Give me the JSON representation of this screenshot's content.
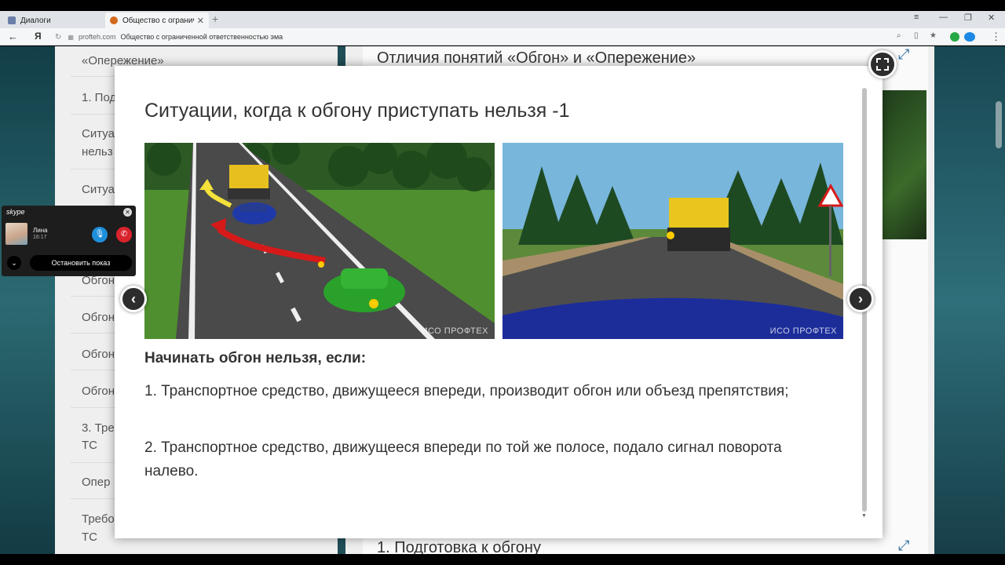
{
  "browser": {
    "tabs": [
      {
        "title": "Диалоги",
        "active": false
      },
      {
        "title": "Общество с ограниченн",
        "active": true
      }
    ],
    "new_tab_glyph": "+",
    "window_controls": [
      "≡",
      "—",
      "❐",
      "✕"
    ],
    "back_glyph": "←",
    "yandex_glyph": "Я",
    "url_domain": "profteh.com",
    "page_title_in_addr": "Общество с ограниченной ответственностью эма"
  },
  "sidebar": {
    "items": [
      "«Опережение»",
      "1. Под",
      "Ситуа",
      "нельз",
      "Ситуа",
      "Обгон",
      "Обгон",
      "Обгон",
      "Обгон",
      "3. Тре",
      "ТС",
      "Опер",
      "Требо",
      "ТС"
    ]
  },
  "content": {
    "heading_top": "Отличия понятий «Обгон» и «Опережение»",
    "heading_bottom": "1. Подготовка к обгону"
  },
  "modal": {
    "title": "Ситуации, когда к обгону приступать нельзя -1",
    "watermark": "ИСО ПРОФТЕХ",
    "lead": "Начинать обгон нельзя, если:",
    "points": [
      "1. Транспортное средство, движущееся впереди, производит обгон или объезд препятствия;",
      "2. Транспортное средство, движущееся впереди по той же полосе, подало сигнал поворота налево."
    ],
    "prev_glyph": "‹",
    "next_glyph": "›"
  },
  "skype": {
    "logo": "skype",
    "caller_name": "Лина",
    "call_time": "16:17",
    "stop_label": "Остановить показ",
    "close_glyph": "✕",
    "mic_glyph": "🎙",
    "hang_glyph": "✆",
    "chevron_glyph": "⌄"
  },
  "colors": {
    "accent": "#2c6b9c",
    "mic": "#1e8fdb",
    "hangup": "#d9232d"
  }
}
